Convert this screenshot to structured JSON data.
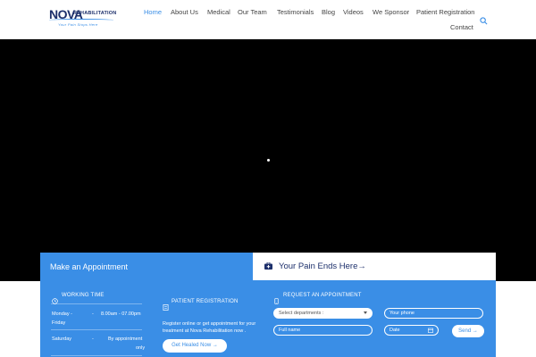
{
  "header": {
    "logo": {
      "name": "NOVA",
      "suffix": "REHABILITATION",
      "tagline": "Your Pain Stops Here"
    },
    "nav": [
      {
        "label": "Home",
        "active": true
      },
      {
        "label": "About Us"
      },
      {
        "label": "Medical"
      },
      {
        "label": "Our Team"
      },
      {
        "label": "Testimonials"
      },
      {
        "label": "Blog"
      },
      {
        "label": "Videos"
      },
      {
        "label": "We Sponsor"
      },
      {
        "label": "Patient Registration"
      },
      {
        "label": "Contact"
      }
    ],
    "search_icon": "search-icon"
  },
  "appointment": {
    "title": "Make an Appointment",
    "pain_title": "Your Pain Ends Here→",
    "working_time": {
      "title": "WORKING TIME",
      "rows": [
        {
          "day": "Monday - Friday",
          "dash": "-",
          "hours": "8.00am - 07.00pm"
        },
        {
          "day": "Saturday",
          "dash": "-",
          "hours": "By appointment only"
        }
      ]
    },
    "registration": {
      "title": "PATIENT REGISTRATION",
      "text": "Register online or get appointment for your treatment at Nova Rehabilitation now .",
      "button": "Get Healed Now →"
    },
    "request": {
      "title": "REQUEST AN APPOINTMENT",
      "department_select": "Select departments :",
      "phone_placeholder": "Your phone",
      "name_placeholder": "Full name",
      "date_placeholder": "Date",
      "send_button": "Send →"
    }
  },
  "colors": {
    "brand_blue": "#3a8ee6",
    "navy": "#1c2f6b",
    "hero_bg": "#000000"
  }
}
